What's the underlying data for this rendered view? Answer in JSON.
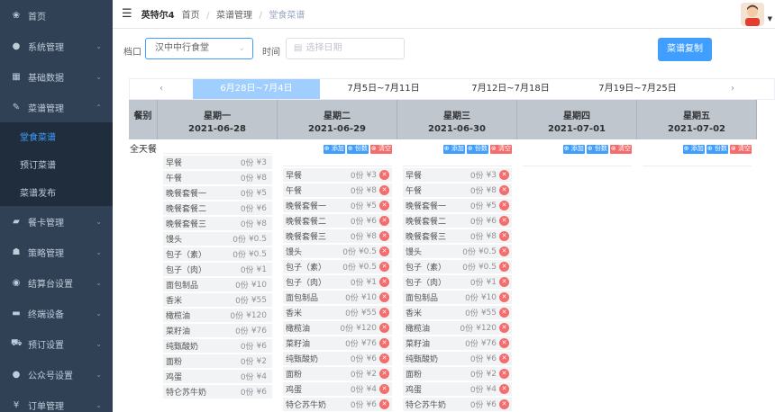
{
  "sidebar": {
    "items": [
      {
        "label": "首页",
        "icon": "dashboard-icon",
        "glyph": "❀",
        "arrow": ""
      },
      {
        "label": "系统管理",
        "icon": "user-icon",
        "glyph": "●",
        "arrow": "⌄"
      },
      {
        "label": "基础数据",
        "icon": "grid-icon",
        "glyph": "▦",
        "arrow": "⌄"
      },
      {
        "label": "菜谱管理",
        "icon": "edit-icon",
        "glyph": "✎",
        "arrow": "⌃"
      }
    ],
    "submenu": [
      {
        "label": "堂食菜谱",
        "active": true
      },
      {
        "label": "预订菜谱",
        "active": false
      },
      {
        "label": "菜谱发布",
        "active": false
      }
    ],
    "items_after": [
      {
        "label": "餐卡管理",
        "icon": "card-icon",
        "glyph": "▰",
        "arrow": "⌄"
      },
      {
        "label": "策略管理",
        "icon": "strategy-icon",
        "glyph": "☗",
        "arrow": "⌄"
      },
      {
        "label": "结算台设置",
        "icon": "eye-icon",
        "glyph": "◉",
        "arrow": "⌄"
      },
      {
        "label": "终端设备",
        "icon": "device-icon",
        "glyph": "▬",
        "arrow": "⌄"
      },
      {
        "label": "预订设置",
        "icon": "cart-icon",
        "glyph": "⛟",
        "arrow": "⌄"
      },
      {
        "label": "公众号设置",
        "icon": "chat-icon",
        "glyph": "●",
        "arrow": "⌄"
      },
      {
        "label": "订单管理",
        "icon": "yen-icon",
        "glyph": "¥",
        "arrow": "⌄"
      }
    ]
  },
  "topbar": {
    "brand": "英特尔4",
    "breadcrumb": [
      "首页",
      "菜谱管理",
      "堂食菜谱"
    ],
    "separator": "/"
  },
  "filters": {
    "stall_label": "档口",
    "stall_value": "汉中中行食堂",
    "time_label": "时间",
    "date_placeholder": "选择日期",
    "copy_button": "菜谱复制"
  },
  "weeks": {
    "prev": "‹",
    "next": "›",
    "tabs": [
      "6月28日~7月4日",
      "7月5日~7月11日",
      "7月12日~7月18日",
      "7月19日~7月25日"
    ],
    "active_index": 0
  },
  "grid": {
    "meal_header": "餐别",
    "meal_label": "全天餐",
    "actions": {
      "add": "添加",
      "portion": "份数",
      "clear": "清空"
    },
    "days": [
      {
        "weekday": "星期一",
        "date": "2021-06-28",
        "items": [
          {
            "name": "早餐",
            "qty": "0份",
            "price": "¥3"
          },
          {
            "name": "午餐",
            "qty": "0份",
            "price": "¥8"
          },
          {
            "name": "晚餐套餐一",
            "qty": "0份",
            "price": "¥5"
          },
          {
            "name": "晚餐套餐二",
            "qty": "0份",
            "price": "¥6"
          },
          {
            "name": "晚餐套餐三",
            "qty": "0份",
            "price": "¥8"
          },
          {
            "name": "馒头",
            "qty": "0份",
            "price": "¥0.5"
          },
          {
            "name": "包子（素）",
            "qty": "0份",
            "price": "¥0.5"
          },
          {
            "name": "包子（肉）",
            "qty": "0份",
            "price": "¥1"
          },
          {
            "name": "面包制品",
            "qty": "0份",
            "price": "¥10"
          },
          {
            "name": "香米",
            "qty": "0份",
            "price": "¥55"
          },
          {
            "name": "橄榄油",
            "qty": "0份",
            "price": "¥120"
          },
          {
            "name": "菜籽油",
            "qty": "0份",
            "price": "¥76"
          },
          {
            "name": "纯甄酸奶",
            "qty": "0份",
            "price": "¥6"
          },
          {
            "name": "面粉",
            "qty": "0份",
            "price": "¥2"
          },
          {
            "name": "鸡蛋",
            "qty": "0份",
            "price": "¥4"
          },
          {
            "name": "特仑苏牛奶",
            "qty": "0份",
            "price": "¥6"
          }
        ]
      },
      {
        "weekday": "星期二",
        "date": "2021-06-29",
        "items": [
          {
            "name": "早餐",
            "qty": "0份",
            "price": "¥3"
          },
          {
            "name": "午餐",
            "qty": "0份",
            "price": "¥8"
          },
          {
            "name": "晚餐套餐一",
            "qty": "0份",
            "price": "¥5"
          },
          {
            "name": "晚餐套餐二",
            "qty": "0份",
            "price": "¥6"
          },
          {
            "name": "晚餐套餐三",
            "qty": "0份",
            "price": "¥8"
          },
          {
            "name": "馒头",
            "qty": "0份",
            "price": "¥0.5"
          },
          {
            "name": "包子（素）",
            "qty": "0份",
            "price": "¥0.5"
          },
          {
            "name": "包子（肉）",
            "qty": "0份",
            "price": "¥1"
          },
          {
            "name": "面包制品",
            "qty": "0份",
            "price": "¥10"
          },
          {
            "name": "香米",
            "qty": "0份",
            "price": "¥55"
          },
          {
            "name": "橄榄油",
            "qty": "0份",
            "price": "¥120"
          },
          {
            "name": "菜籽油",
            "qty": "0份",
            "price": "¥76"
          },
          {
            "name": "纯甄酸奶",
            "qty": "0份",
            "price": "¥6"
          },
          {
            "name": "面粉",
            "qty": "0份",
            "price": "¥2"
          },
          {
            "name": "鸡蛋",
            "qty": "0份",
            "price": "¥4"
          },
          {
            "name": "特仑苏牛奶",
            "qty": "0份",
            "price": "¥6"
          }
        ]
      },
      {
        "weekday": "星期三",
        "date": "2021-06-30",
        "items": [
          {
            "name": "早餐",
            "qty": "0份",
            "price": "¥3"
          },
          {
            "name": "午餐",
            "qty": "0份",
            "price": "¥8"
          },
          {
            "name": "晚餐套餐一",
            "qty": "0份",
            "price": "¥5"
          },
          {
            "name": "晚餐套餐二",
            "qty": "0份",
            "price": "¥6"
          },
          {
            "name": "晚餐套餐三",
            "qty": "0份",
            "price": "¥8"
          },
          {
            "name": "馒头",
            "qty": "0份",
            "price": "¥0.5"
          },
          {
            "name": "包子（素）",
            "qty": "0份",
            "price": "¥0.5"
          },
          {
            "name": "包子（肉）",
            "qty": "0份",
            "price": "¥1"
          },
          {
            "name": "面包制品",
            "qty": "0份",
            "price": "¥10"
          },
          {
            "name": "香米",
            "qty": "0份",
            "price": "¥55"
          },
          {
            "name": "橄榄油",
            "qty": "0份",
            "price": "¥120"
          },
          {
            "name": "菜籽油",
            "qty": "0份",
            "price": "¥76"
          },
          {
            "name": "纯甄酸奶",
            "qty": "0份",
            "price": "¥6"
          },
          {
            "name": "面粉",
            "qty": "0份",
            "price": "¥2"
          },
          {
            "name": "鸡蛋",
            "qty": "0份",
            "price": "¥4"
          },
          {
            "name": "特仑苏牛奶",
            "qty": "0份",
            "price": "¥6"
          }
        ]
      },
      {
        "weekday": "星期四",
        "date": "2021-07-01",
        "items": []
      },
      {
        "weekday": "星期五",
        "date": "2021-07-02",
        "items": []
      }
    ]
  }
}
